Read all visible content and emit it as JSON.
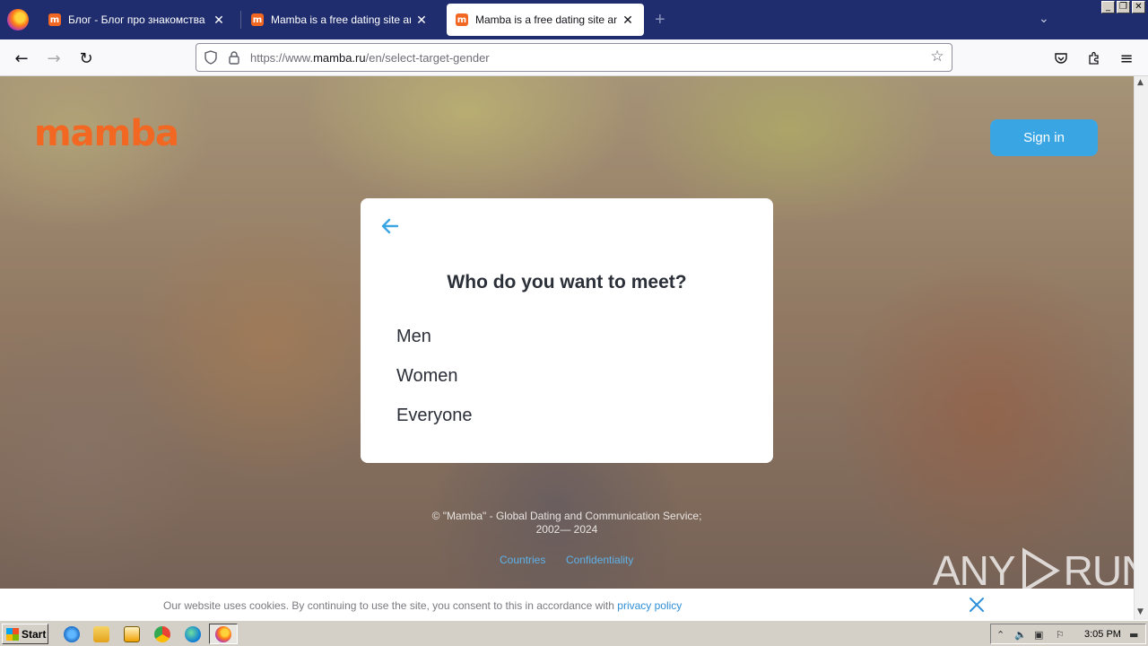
{
  "browser": {
    "tabs": [
      {
        "title": "Блог - Блог про знакомства и отн",
        "favicon": "m"
      },
      {
        "title": "Mamba is a free dating site and a c",
        "favicon": "m"
      },
      {
        "title": "Mamba is a free dating site and a c",
        "favicon": "m",
        "active": true
      }
    ],
    "new_tab_label": "+",
    "url_prefix": "https://www.",
    "url_domain": "mamba.ru",
    "url_path": "/en/select-target-gender"
  },
  "page": {
    "logo_text": "mamba",
    "signin_label": "Sign in",
    "card": {
      "title": "Who do you want to meet?",
      "options": [
        "Men",
        "Women",
        "Everyone"
      ]
    },
    "footer": {
      "copyright_line1": "© \"Mamba\" - Global Dating and Communication Service;",
      "copyright_line2": "2002— 2024",
      "links": [
        "Countries",
        "Confidentiality"
      ]
    },
    "watermark_left": "ANY",
    "watermark_right": "RUN"
  },
  "cookie": {
    "text": "Our website uses cookies. By continuing to use the site, you consent to this in accordance with ",
    "link": "privacy policy"
  },
  "taskbar": {
    "start_label": "Start",
    "clock": "3:05 PM"
  },
  "colors": {
    "brand": "#f26722",
    "signin": "#3aa5e3",
    "link": "#2f8fd8"
  }
}
